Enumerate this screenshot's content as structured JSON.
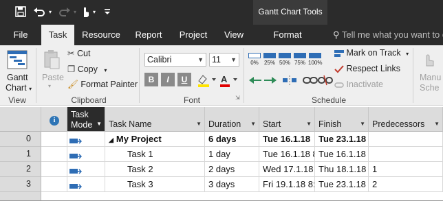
{
  "context_tab_group": "Gantt Chart Tools",
  "tabs": [
    "File",
    "Task",
    "Resource",
    "Report",
    "Project",
    "View",
    "Format"
  ],
  "tell_me_placeholder": "Tell me what you want to do",
  "ribbon": {
    "view_group": {
      "gantt_chart_label_1": "Gantt",
      "gantt_chart_label_2": "Chart",
      "group_label": "View"
    },
    "clipboard_group": {
      "paste_label": "Paste",
      "cut_label": "Cut",
      "copy_label": "Copy",
      "format_painter_label": "Format Painter",
      "group_label": "Clipboard"
    },
    "font_group": {
      "font_name": "Calibri",
      "font_size": "11",
      "bold": "B",
      "italic": "I",
      "underline": "U",
      "group_label": "Font"
    },
    "schedule_group": {
      "percent_buttons": [
        "0%",
        "25%",
        "50%",
        "75%",
        "100%"
      ],
      "mark_on_track_label": "Mark on Track",
      "respect_links_label": "Respect Links",
      "inactivate_label": "Inactivate",
      "group_label": "Schedule"
    },
    "manual_schedule_label_1": "Manu",
    "manual_schedule_label_2": "Sche"
  },
  "grid": {
    "columns": {
      "task_mode": [
        "Task",
        "Mode"
      ],
      "task_name": "Task Name",
      "duration": "Duration",
      "start": "Start",
      "finish": "Finish",
      "predecessors": "Predecessors"
    },
    "rows": [
      {
        "id": "0",
        "name": "My Project",
        "duration": "6 days",
        "start": "Tue 16.1.18",
        "finish": "Tue 23.1.18",
        "predecessors": ""
      },
      {
        "id": "1",
        "name": "Task 1",
        "duration": "1 day",
        "start": "Tue 16.1.18 8",
        "finish": "Tue 16.1.18 1",
        "predecessors": ""
      },
      {
        "id": "2",
        "name": "Task 2",
        "duration": "2 days",
        "start": "Wed 17.1.18",
        "finish": "Thu 18.1.18 1",
        "predecessors": "1"
      },
      {
        "id": "3",
        "name": "Task 3",
        "duration": "3 days",
        "start": "Fri 19.1.18 8:",
        "finish": "Tue 23.1.18 1",
        "predecessors": "2"
      }
    ]
  },
  "colors": {
    "titlebar": "#2b2b2b",
    "context_group": "#3b3b3b",
    "ribbon": "#efefef",
    "accent_blue": "#2e6db5",
    "info_blue": "#2e75b6"
  }
}
